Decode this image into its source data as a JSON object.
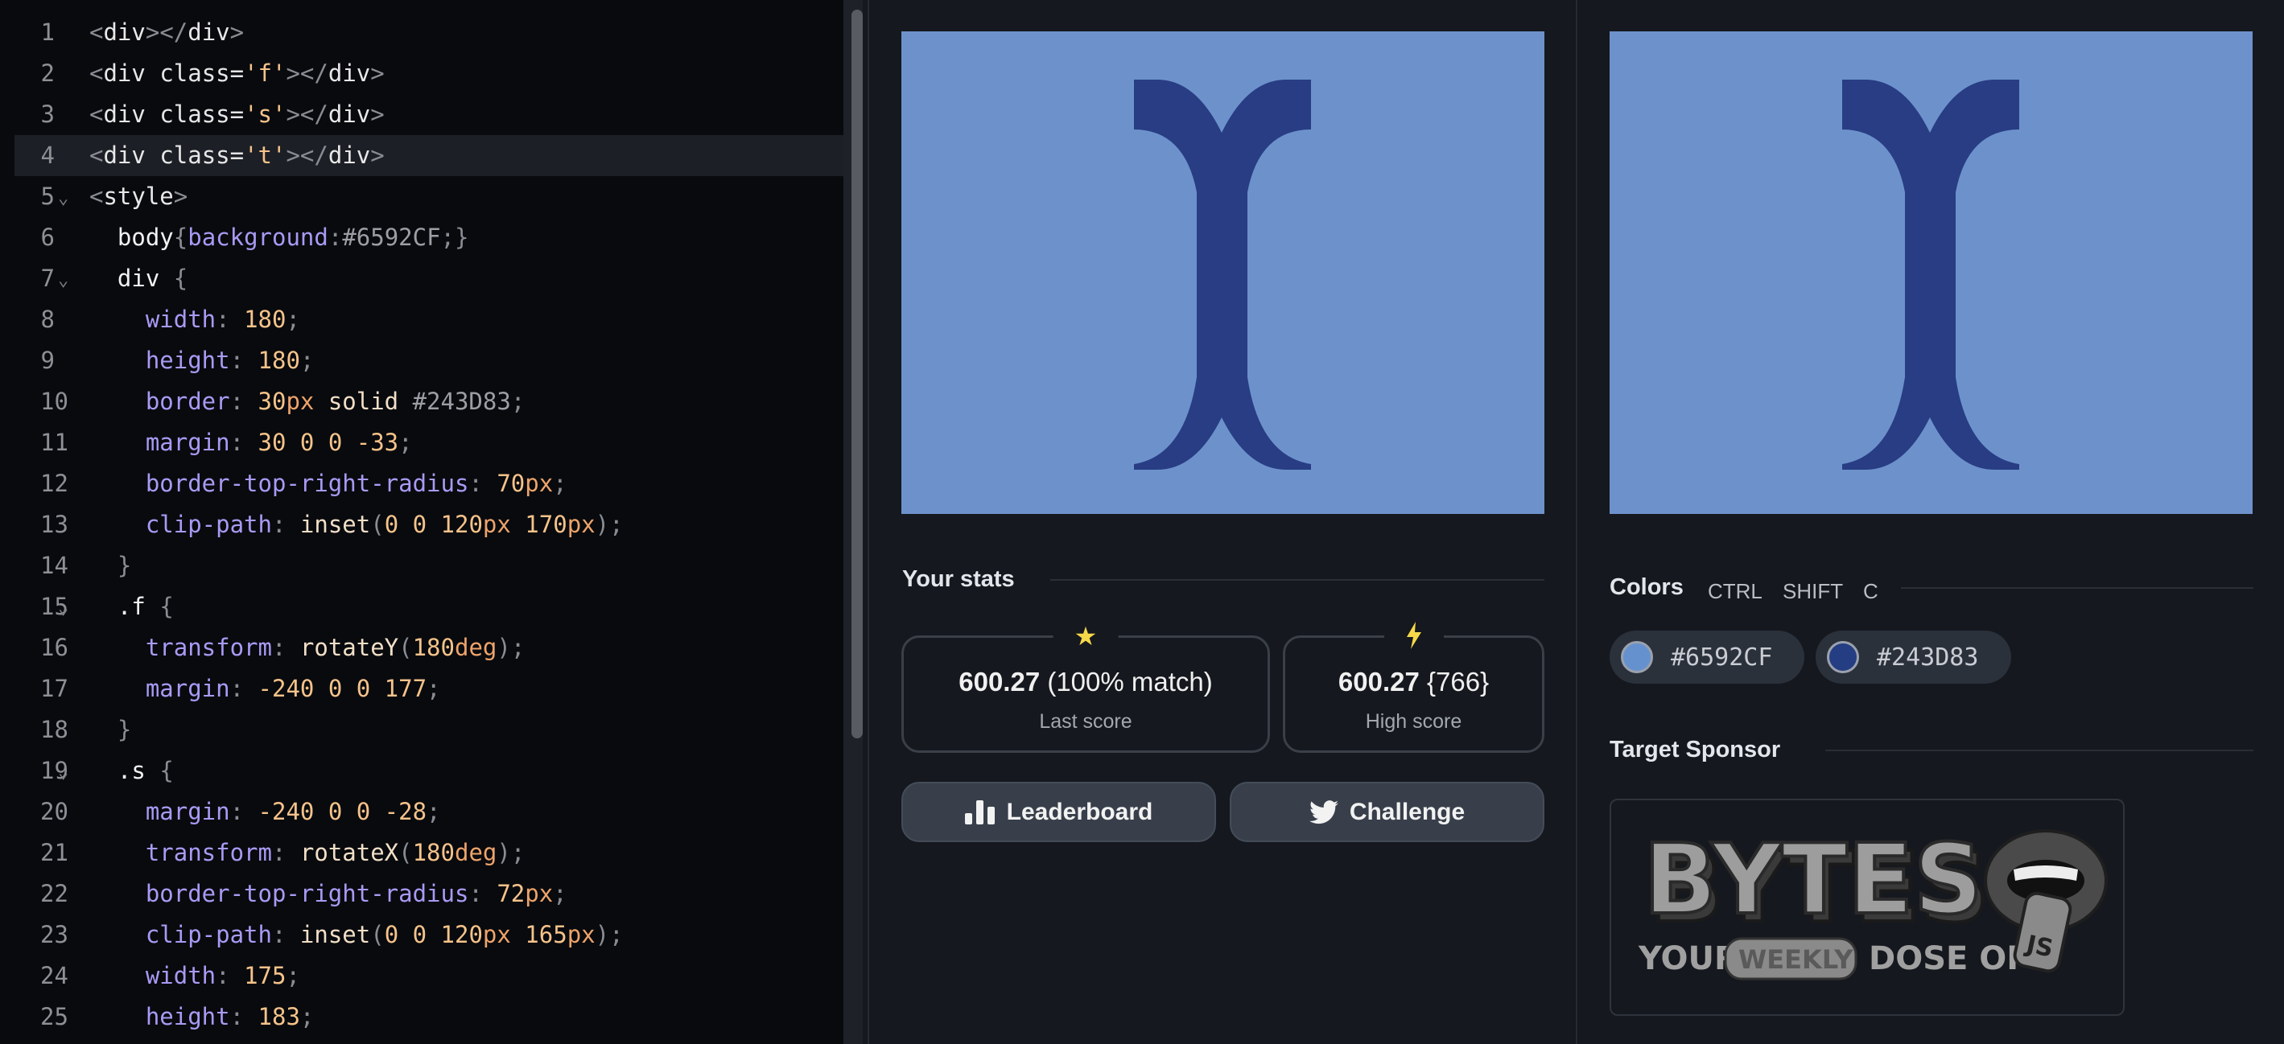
{
  "editor": {
    "lines": [
      {
        "n": "1",
        "fold": false,
        "tokens": [
          {
            "t": "<",
            "c": "punc"
          },
          {
            "t": "div",
            "c": "tag"
          },
          {
            "t": "></",
            "c": "punc"
          },
          {
            "t": "div",
            "c": "tag"
          },
          {
            "t": ">",
            "c": "punc"
          }
        ]
      },
      {
        "n": "2",
        "fold": false,
        "tokens": [
          {
            "t": "<",
            "c": "punc"
          },
          {
            "t": "div ",
            "c": "tag"
          },
          {
            "t": "class=",
            "c": "attr"
          },
          {
            "t": "'f'",
            "c": "str"
          },
          {
            "t": "></",
            "c": "punc"
          },
          {
            "t": "div",
            "c": "tag"
          },
          {
            "t": ">",
            "c": "punc"
          }
        ]
      },
      {
        "n": "3",
        "fold": false,
        "tokens": [
          {
            "t": "<",
            "c": "punc"
          },
          {
            "t": "div ",
            "c": "tag"
          },
          {
            "t": "class=",
            "c": "attr"
          },
          {
            "t": "'s'",
            "c": "str"
          },
          {
            "t": "></",
            "c": "punc"
          },
          {
            "t": "div",
            "c": "tag"
          },
          {
            "t": ">",
            "c": "punc"
          }
        ]
      },
      {
        "n": "4",
        "fold": false,
        "active": true,
        "tokens": [
          {
            "t": "<",
            "c": "punc"
          },
          {
            "t": "div ",
            "c": "tag"
          },
          {
            "t": "class=",
            "c": "attr"
          },
          {
            "t": "'t'",
            "c": "str"
          },
          {
            "t": "></",
            "c": "punc"
          },
          {
            "t": "div",
            "c": "tag"
          },
          {
            "t": ">",
            "c": "punc"
          }
        ]
      },
      {
        "n": "5",
        "fold": true,
        "tokens": [
          {
            "t": "<",
            "c": "punc"
          },
          {
            "t": "style",
            "c": "tag"
          },
          {
            "t": ">",
            "c": "punc"
          }
        ]
      },
      {
        "n": "6",
        "fold": false,
        "tokens": [
          {
            "t": "  body",
            "c": "sel"
          },
          {
            "t": "{",
            "c": "punc"
          },
          {
            "t": "background",
            "c": "prop"
          },
          {
            "t": ":",
            "c": "punc"
          },
          {
            "t": "#6592CF",
            "c": "hex"
          },
          {
            "t": ";}",
            "c": "punc"
          }
        ]
      },
      {
        "n": "7",
        "fold": true,
        "tokens": [
          {
            "t": "  div ",
            "c": "sel"
          },
          {
            "t": "{",
            "c": "punc"
          }
        ]
      },
      {
        "n": "8",
        "fold": false,
        "tokens": [
          {
            "t": "    width",
            "c": "prop"
          },
          {
            "t": ": ",
            "c": "punc"
          },
          {
            "t": "180",
            "c": "num"
          },
          {
            "t": ";",
            "c": "punc"
          }
        ]
      },
      {
        "n": "9",
        "fold": false,
        "tokens": [
          {
            "t": "    height",
            "c": "prop"
          },
          {
            "t": ": ",
            "c": "punc"
          },
          {
            "t": "180",
            "c": "num"
          },
          {
            "t": ";",
            "c": "punc"
          }
        ]
      },
      {
        "n": "10",
        "fold": false,
        "tokens": [
          {
            "t": "    border",
            "c": "prop"
          },
          {
            "t": ": ",
            "c": "punc"
          },
          {
            "t": "30",
            "c": "num"
          },
          {
            "t": "px",
            "c": "unit"
          },
          {
            "t": " solid ",
            "c": "fn"
          },
          {
            "t": "#243D83",
            "c": "hex"
          },
          {
            "t": ";",
            "c": "punc"
          }
        ]
      },
      {
        "n": "11",
        "fold": false,
        "tokens": [
          {
            "t": "    margin",
            "c": "prop"
          },
          {
            "t": ": ",
            "c": "punc"
          },
          {
            "t": "30 0 0 -33",
            "c": "num"
          },
          {
            "t": ";",
            "c": "punc"
          }
        ]
      },
      {
        "n": "12",
        "fold": false,
        "tokens": [
          {
            "t": "    border-top-right-radius",
            "c": "prop"
          },
          {
            "t": ": ",
            "c": "punc"
          },
          {
            "t": "70",
            "c": "num"
          },
          {
            "t": "px",
            "c": "unit"
          },
          {
            "t": ";",
            "c": "punc"
          }
        ]
      },
      {
        "n": "13",
        "fold": false,
        "tokens": [
          {
            "t": "    clip-path",
            "c": "prop"
          },
          {
            "t": ": ",
            "c": "punc"
          },
          {
            "t": "inset",
            "c": "fn"
          },
          {
            "t": "(",
            "c": "punc"
          },
          {
            "t": "0 0 120",
            "c": "num"
          },
          {
            "t": "px ",
            "c": "unit"
          },
          {
            "t": "170",
            "c": "num"
          },
          {
            "t": "px",
            "c": "unit"
          },
          {
            "t": ");",
            "c": "punc"
          }
        ]
      },
      {
        "n": "14",
        "fold": false,
        "tokens": [
          {
            "t": "  }",
            "c": "punc"
          }
        ]
      },
      {
        "n": "15",
        "fold": true,
        "tokens": [
          {
            "t": "  .f ",
            "c": "sel"
          },
          {
            "t": "{",
            "c": "punc"
          }
        ]
      },
      {
        "n": "16",
        "fold": false,
        "tokens": [
          {
            "t": "    transform",
            "c": "prop"
          },
          {
            "t": ": ",
            "c": "punc"
          },
          {
            "t": "rotateY",
            "c": "fn"
          },
          {
            "t": "(",
            "c": "punc"
          },
          {
            "t": "180",
            "c": "num"
          },
          {
            "t": "deg",
            "c": "unit"
          },
          {
            "t": ");",
            "c": "punc"
          }
        ]
      },
      {
        "n": "17",
        "fold": false,
        "tokens": [
          {
            "t": "    margin",
            "c": "prop"
          },
          {
            "t": ": ",
            "c": "punc"
          },
          {
            "t": "-240 0 0 177",
            "c": "num"
          },
          {
            "t": ";",
            "c": "punc"
          }
        ]
      },
      {
        "n": "18",
        "fold": false,
        "tokens": [
          {
            "t": "  }",
            "c": "punc"
          }
        ]
      },
      {
        "n": "19",
        "fold": true,
        "tokens": [
          {
            "t": "  .s ",
            "c": "sel"
          },
          {
            "t": "{",
            "c": "punc"
          }
        ]
      },
      {
        "n": "20",
        "fold": false,
        "tokens": [
          {
            "t": "    margin",
            "c": "prop"
          },
          {
            "t": ": ",
            "c": "punc"
          },
          {
            "t": "-240 0 0 -28",
            "c": "num"
          },
          {
            "t": ";",
            "c": "punc"
          }
        ]
      },
      {
        "n": "21",
        "fold": false,
        "tokens": [
          {
            "t": "    transform",
            "c": "prop"
          },
          {
            "t": ": ",
            "c": "punc"
          },
          {
            "t": "rotateX",
            "c": "fn"
          },
          {
            "t": "(",
            "c": "punc"
          },
          {
            "t": "180",
            "c": "num"
          },
          {
            "t": "deg",
            "c": "unit"
          },
          {
            "t": ");",
            "c": "punc"
          }
        ]
      },
      {
        "n": "22",
        "fold": false,
        "tokens": [
          {
            "t": "    border-top-right-radius",
            "c": "prop"
          },
          {
            "t": ": ",
            "c": "punc"
          },
          {
            "t": "72",
            "c": "num"
          },
          {
            "t": "px",
            "c": "unit"
          },
          {
            "t": ";",
            "c": "punc"
          }
        ]
      },
      {
        "n": "23",
        "fold": false,
        "tokens": [
          {
            "t": "    clip-path",
            "c": "prop"
          },
          {
            "t": ": ",
            "c": "punc"
          },
          {
            "t": "inset",
            "c": "fn"
          },
          {
            "t": "(",
            "c": "punc"
          },
          {
            "t": "0 0 120",
            "c": "num"
          },
          {
            "t": "px ",
            "c": "unit"
          },
          {
            "t": "165",
            "c": "num"
          },
          {
            "t": "px",
            "c": "unit"
          },
          {
            "t": ");",
            "c": "punc"
          }
        ]
      },
      {
        "n": "24",
        "fold": false,
        "tokens": [
          {
            "t": "    width",
            "c": "prop"
          },
          {
            "t": ": ",
            "c": "punc"
          },
          {
            "t": "175",
            "c": "num"
          },
          {
            "t": ";",
            "c": "punc"
          }
        ]
      },
      {
        "n": "25",
        "fold": false,
        "tokens": [
          {
            "t": "    height",
            "c": "prop"
          },
          {
            "t": ": ",
            "c": "punc"
          },
          {
            "t": "183",
            "c": "num"
          },
          {
            "t": ";",
            "c": "punc"
          }
        ]
      }
    ]
  },
  "output_canvas": {
    "background": "#6d92cb",
    "shape_color": "#283d84"
  },
  "target_canvas": {
    "background": "#6d92cb",
    "shape_color": "#283d84"
  },
  "stats": {
    "title": "Your stats",
    "last": {
      "icon": "star-icon",
      "value": "600.27",
      "extra": "(100% match)",
      "label": "Last score",
      "icon_color": "#f7d84a"
    },
    "high": {
      "icon": "lightning-icon",
      "value": "600.27",
      "extra": "{766}",
      "label": "High score",
      "icon_color": "#f7d84a"
    }
  },
  "buttons": {
    "leaderboard": {
      "label": "Leaderboard",
      "icon": "bar-chart-icon"
    },
    "challenge": {
      "label": "Challenge",
      "icon": "twitter-icon"
    }
  },
  "colors": {
    "title": "Colors",
    "shortcut": [
      "CTRL",
      "SHIFT",
      "C"
    ],
    "swatches": [
      {
        "hex": "#6592CF",
        "label": "#6592CF"
      },
      {
        "hex": "#243D83",
        "label": "#243D83"
      }
    ]
  },
  "sponsor": {
    "title": "Target Sponsor",
    "logo_word": "BYTES",
    "tagline_1": "YOUR",
    "tagline_2": "WEEKLY",
    "tagline_3": "DOSE OF",
    "badge": "JS"
  }
}
